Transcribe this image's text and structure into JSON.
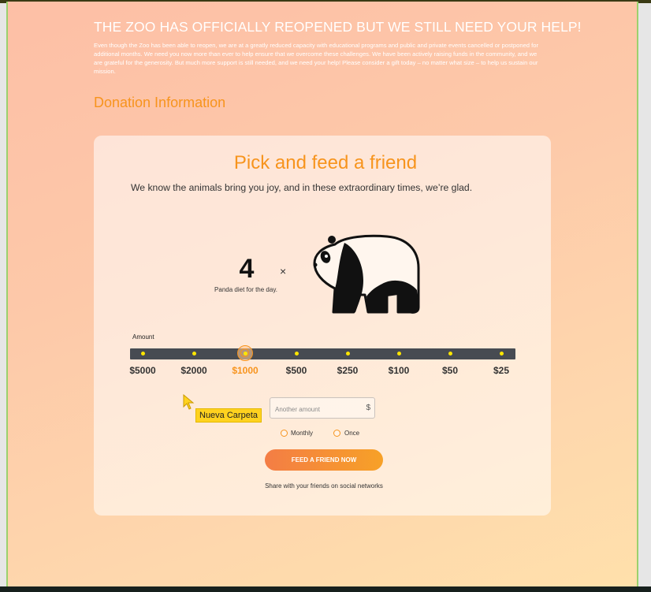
{
  "banner": {
    "headline": "THE ZOO HAS OFFICIALLY REOPENED BUT WE STILL NEED YOUR HELP!",
    "body": "Even though the Zoo has been able to reopen, we are at a greatly reduced capacity with educational programs and public and private events cancelled or postponed for additional months. We need you now more than ever to help ensure that we overcome these challenges. We have been actively raising funds in the community, and we are grateful for the generosity. But much more support is still needed, and we need your help! Please consider a gift today – no matter what size – to help us sustain our mission."
  },
  "section_title": "Donation Information",
  "card": {
    "title": "Pick and feed a friend",
    "subtitle": "We know the animals bring you joy, and in these extraordinary times, we’re glad.",
    "multiplier": {
      "count": "4",
      "times_symbol": "×",
      "label": "Panda diet for the day.",
      "animal_icon": "panda-icon"
    },
    "amount": {
      "label": "Amount",
      "options": [
        "$5000",
        "$2000",
        "$1000",
        "$500",
        "$250",
        "$100",
        "$50",
        "$25"
      ],
      "selected": "$1000",
      "selected_index": 2
    },
    "custom_amount": {
      "placeholder": "Another amount",
      "value": "",
      "currency_symbol": "$"
    },
    "frequency": {
      "options": [
        "Monthly",
        "Once"
      ]
    },
    "cta_label": "FEED A FRIEND NOW",
    "share_text": "Share with your friends on social networks"
  },
  "overlay": {
    "tooltip": "Nueva Carpeta"
  },
  "colors": {
    "accent": "#f7941d",
    "track": "#474b52",
    "tick": "#ffe600",
    "tooltip": "#ffd21f"
  }
}
